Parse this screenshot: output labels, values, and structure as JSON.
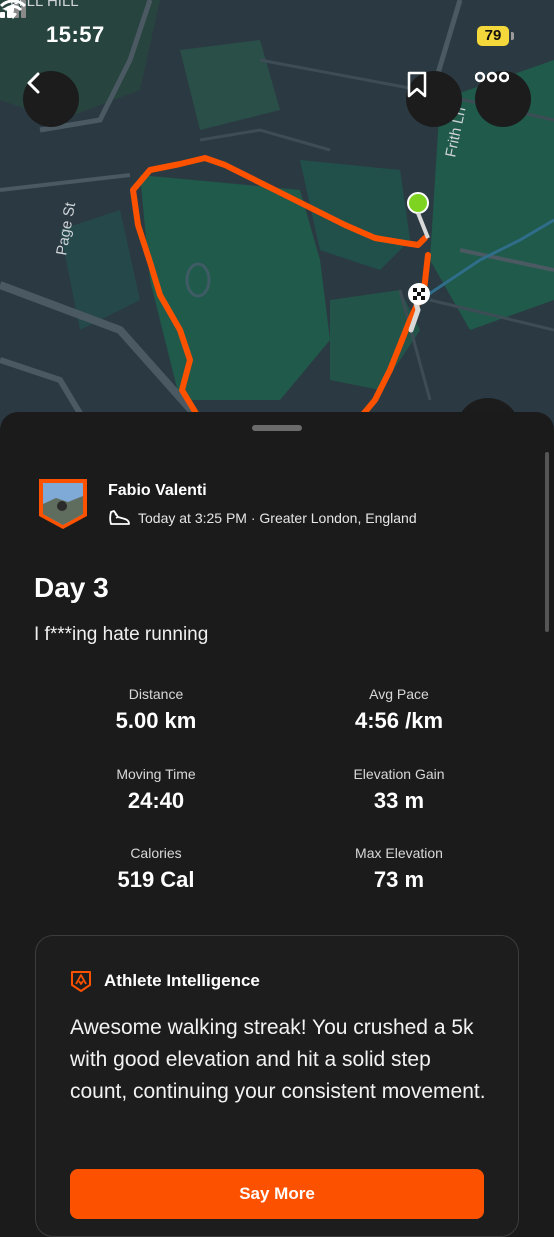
{
  "status_bar": {
    "time": "15:57",
    "battery": "79"
  },
  "map": {
    "labels": {
      "mill_hill": "MILL HILL",
      "page_st": "Page St",
      "frith_ln": "Frith Ln"
    },
    "route_color": "#fc5200",
    "start_color": "#7ed321"
  },
  "toolbar": {
    "back_icon": "chevron-left-icon",
    "save_icon": "bookmark-icon",
    "more_icon": "more-icon"
  },
  "activity": {
    "athlete_name": "Fabio Valenti",
    "meta": "Today at 3:25 PM · Greater London, England",
    "title": "Day 3",
    "description": "I f***ing hate running"
  },
  "stats": [
    {
      "label": "Distance",
      "value": "5.00 km"
    },
    {
      "label": "Avg Pace",
      "value": "4:56 /km"
    },
    {
      "label": "Moving Time",
      "value": "24:40"
    },
    {
      "label": "Elevation Gain",
      "value": "33 m"
    },
    {
      "label": "Calories",
      "value": "519 Cal"
    },
    {
      "label": "Max Elevation",
      "value": "73 m"
    }
  ],
  "athlete_intelligence": {
    "title": "Athlete Intelligence",
    "text": "Awesome walking streak! You crushed a 5k with good elevation and hit a solid step count, continuing your consistent movement.",
    "button": "Say More"
  }
}
